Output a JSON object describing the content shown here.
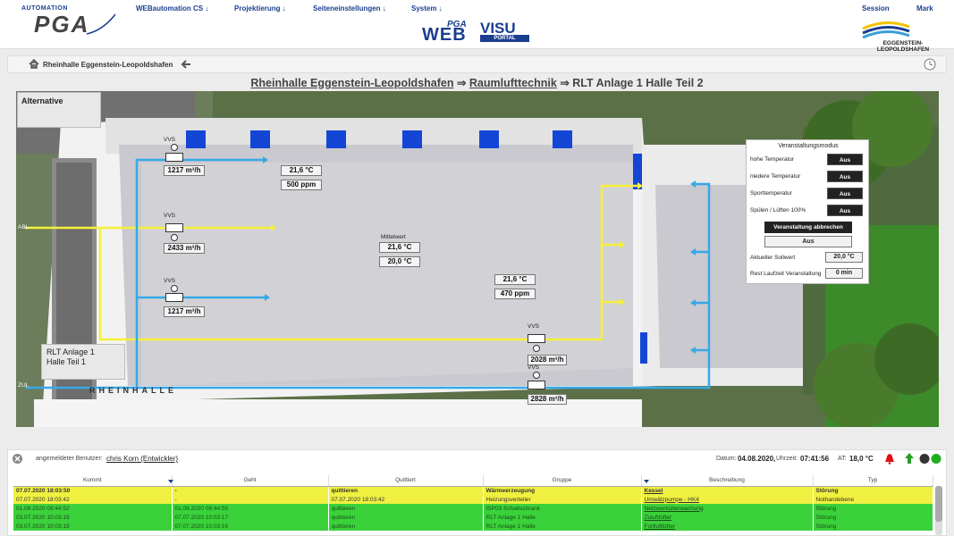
{
  "header": {
    "logo_small": "AUTOMATION",
    "logo_big": "PGA",
    "nav": [
      "WEBautomation CS ↓",
      "Projektierung ↓",
      "Seiteneinstellungen ↓",
      "System ↓"
    ],
    "session": "Session",
    "user_short": "Mark",
    "webvisu_pga": "PGA",
    "webvisu_web": "WEB",
    "webvisu_visu": "VISU",
    "webvisu_portal": "PORTAL",
    "city": "EGGENSTEIN-LEOPOLDSHAFEN"
  },
  "breadcrumb": {
    "home": "Rheinhalle Eggenstein-Leopoldshafen"
  },
  "title": {
    "part1": "Rheinhalle Eggenstein-Leopoldshafen",
    "arrow": " ⇒ ",
    "part2": "Raumlufttechnik",
    "part3": "RLT Anlage 1 Halle Teil 2"
  },
  "scene": {
    "alt_label": "Alternative",
    "rlt_line1": "RLT Anlage 1",
    "rlt_line2": "Halle Teil 1",
    "abl": "ABL",
    "zul": "ZUL",
    "hall_sign": "RHEINHALLE",
    "vvs": "VVS",
    "flow_top": "1217 m³/h",
    "flow_mid": "2433 m³/h",
    "flow_low": "1217 m³/h",
    "flow_r1": "2028 m³/h",
    "flow_r2": "2828 m³/h",
    "temp_top": "21,6 °C",
    "ppm_top": "500 ppm",
    "mittelwert": "Mittelwert",
    "mw_val1": "21,6 °C",
    "mw_val2": "20,0 °C",
    "temp_center": "21,6 °C",
    "ppm_center": "470 ppm"
  },
  "control": {
    "title": "Veranstaltungsmodus",
    "rows": [
      {
        "label": "hohe Temperatur",
        "value": "Aus"
      },
      {
        "label": "niedere Temperatur",
        "value": "Aus"
      },
      {
        "label": "Sporttemperatur",
        "value": "Aus"
      },
      {
        "label": "Spülen / Lüften 100%",
        "value": "Aus"
      }
    ],
    "abort_btn": "Veranstaltung abbrechen",
    "status": "Aus",
    "setpoint_label": "Aktueller Sollwert",
    "setpoint_value": "20,0 °C",
    "rest_label": "Rest Laufzeit Veranstaltung",
    "rest_value": "0 min"
  },
  "statusbar": {
    "user_label": "angemeldeter Benutzer:",
    "user_name": "chris Korn (Entwickler)",
    "date_label": "Datum:",
    "date": "04.08.2020,",
    "time_label": "Uhrzeit:",
    "time": "07:41:56",
    "at_label": "AT:",
    "at_value": "18,0 °C"
  },
  "alarms": {
    "columns": [
      "Kommt",
      "Geht",
      "Quittiert",
      "Gruppe",
      "Beschreibung",
      "Typ"
    ],
    "rows": [
      {
        "kommt": "07.07.2020 18:03:50",
        "geht": "-",
        "quittiert": "quittieren",
        "gruppe": "Wärmeerzeugung",
        "beschreibung": "Kessel",
        "typ": "Störung",
        "state": "y1"
      },
      {
        "kommt": "07.07.2020 18:03:42",
        "geht": "-",
        "quittiert": "07.07.2020 18:03:42",
        "gruppe": "Heizungsverteiler",
        "beschreibung": "Umwälzpumpe - HK4",
        "typ": "Nothandebene",
        "state": "y2"
      },
      {
        "kommt": "01.08.2020 08:44:52",
        "geht": "01.08.2020 08:44:55",
        "quittiert": "quittieren",
        "gruppe": "ISP03 Schaltschrank",
        "beschreibung": "Netzwerküberwachung",
        "typ": "Störung",
        "state": "g"
      },
      {
        "kommt": "03.07.2020 10:03:19",
        "geht": "07.07.2020 10:03:17",
        "quittiert": "quittieren",
        "gruppe": "RLT Anlage 1 Halle",
        "beschreibung": "Zuluftlüfter",
        "typ": "Störung",
        "state": "g"
      },
      {
        "kommt": "03.07.2020 10:03:19",
        "geht": "07.07.2020 10:03:16",
        "quittiert": "quittieren",
        "gruppe": "RLT Anlage 1 Halle",
        "beschreibung": "Fortluftlüfter",
        "typ": "Störung",
        "state": "g"
      }
    ]
  },
  "colors": {
    "supply_air": "#35a8e8",
    "exhaust_air": "#f5ef3a",
    "alarm_yellow": "#f0f040",
    "alarm_green": "#3ad13a",
    "brand": "#1b3f8f"
  }
}
